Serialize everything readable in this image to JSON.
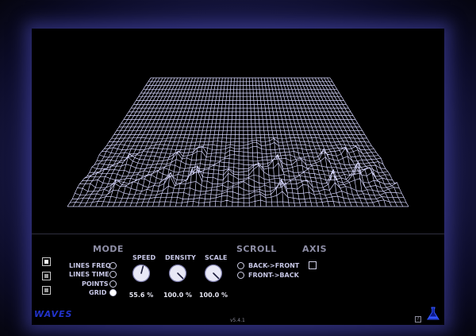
{
  "brand": {
    "name": "WAVES",
    "version": "v5.4.1"
  },
  "view_buttons": [
    {
      "name": "view-1",
      "state": "selected"
    },
    {
      "name": "view-2",
      "state": "normal"
    },
    {
      "name": "view-3",
      "state": "normal"
    }
  ],
  "mode": {
    "title": "MODE",
    "options": [
      {
        "label": "LINES FREQ",
        "selected": false
      },
      {
        "label": "LINES TIME",
        "selected": false
      },
      {
        "label": "POINTS",
        "selected": false
      },
      {
        "label": "GRID",
        "selected": true
      }
    ]
  },
  "knobs": {
    "speed": {
      "label": "SPEED",
      "value": "55.6 %",
      "level": 0.556
    },
    "density": {
      "label": "DENSITY",
      "value": "100.0 %",
      "level": 1.0
    },
    "scale": {
      "label": "SCALE",
      "value": "100.0 %",
      "level": 1.0
    }
  },
  "scroll": {
    "title": "SCROLL",
    "options": [
      {
        "label": "BACK->FRONT",
        "selected": false
      },
      {
        "label": "FRONT->BACK",
        "selected": false
      }
    ]
  },
  "axis": {
    "title": "AXIS",
    "checked": false
  },
  "help": {
    "label": "?"
  },
  "colors": {
    "mesh": "#d8d8ff",
    "accent": "#2233cc",
    "glow": "#3a3a8c"
  },
  "icons": {
    "logo": "flask-icon",
    "help": "help-icon"
  }
}
